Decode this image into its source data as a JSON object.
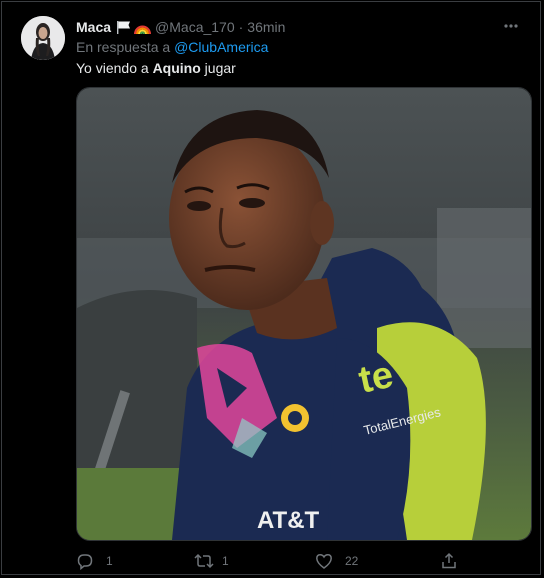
{
  "tweet": {
    "display_name": "Maca",
    "handle": "@Maca_170",
    "separator": "·",
    "time": "36min",
    "reply_prefix": "En respuesta a ",
    "reply_to": "@ClubAmerica",
    "text_before": "Yo viendo a ",
    "text_bold": "Aquino",
    "text_after": " jugar",
    "badges": [
      "white-flag-icon",
      "rainbow-icon"
    ],
    "media_description_icon": "photo"
  },
  "actions": {
    "reply_count": "1",
    "retweet_count": "1",
    "like_count": "22"
  },
  "colors": {
    "background": "#000000",
    "text": "#e7e9ea",
    "secondary": "#71767b",
    "link": "#1d9bf0",
    "jersey_navy": "#1b2a52",
    "jersey_lime": "#b7cf3a",
    "pink_accent": "#e0479b"
  }
}
